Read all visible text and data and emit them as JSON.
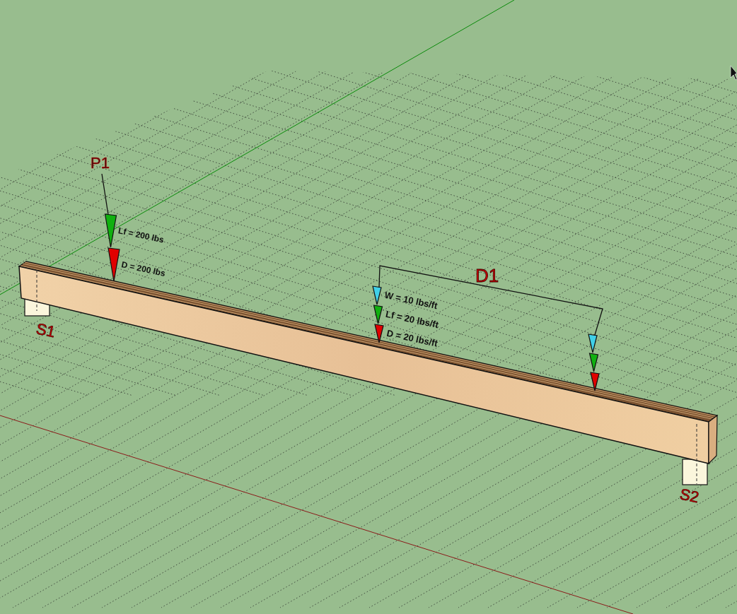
{
  "viewport": {
    "loads": [
      {
        "kind": "point",
        "name": "P1",
        "components": [
          {
            "label": "Lf = 200 lbs",
            "color": "#10b010"
          },
          {
            "label": "D = 200 lbs",
            "color": "#e00000"
          }
        ]
      },
      {
        "kind": "distributed",
        "name": "D1",
        "components": [
          {
            "label": "W = 10 lbs/ft",
            "color": "#40d0e8"
          },
          {
            "label": "Lf = 20 lbs/ft",
            "color": "#10b010"
          },
          {
            "label": "D = 20 lbs/ft",
            "color": "#e00000"
          }
        ]
      }
    ],
    "supports": [
      {
        "name": "S1"
      },
      {
        "name": "S2"
      }
    ]
  }
}
